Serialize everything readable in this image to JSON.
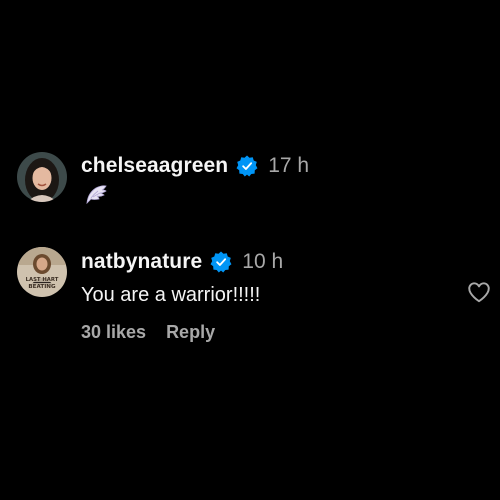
{
  "comments": [
    {
      "username": "chelseaagreen",
      "timestamp": "17 h",
      "emoji": "wing-emoji"
    },
    {
      "username": "natbynature",
      "timestamp": "10 h",
      "text": "You are a warrior!!!!!",
      "likes": "30 likes",
      "reply_label": "Reply",
      "avatar_text_top": "LAST HART",
      "avatar_text_bottom": "BEATING"
    }
  ],
  "colors": {
    "background": "#000000",
    "verified": "#0095f6",
    "secondary_text": "#a8a8a8",
    "primary_text": "#f5f5f5"
  },
  "icons": [
    "verified-badge-icon",
    "wing-emoji-icon",
    "heart-icon"
  ]
}
